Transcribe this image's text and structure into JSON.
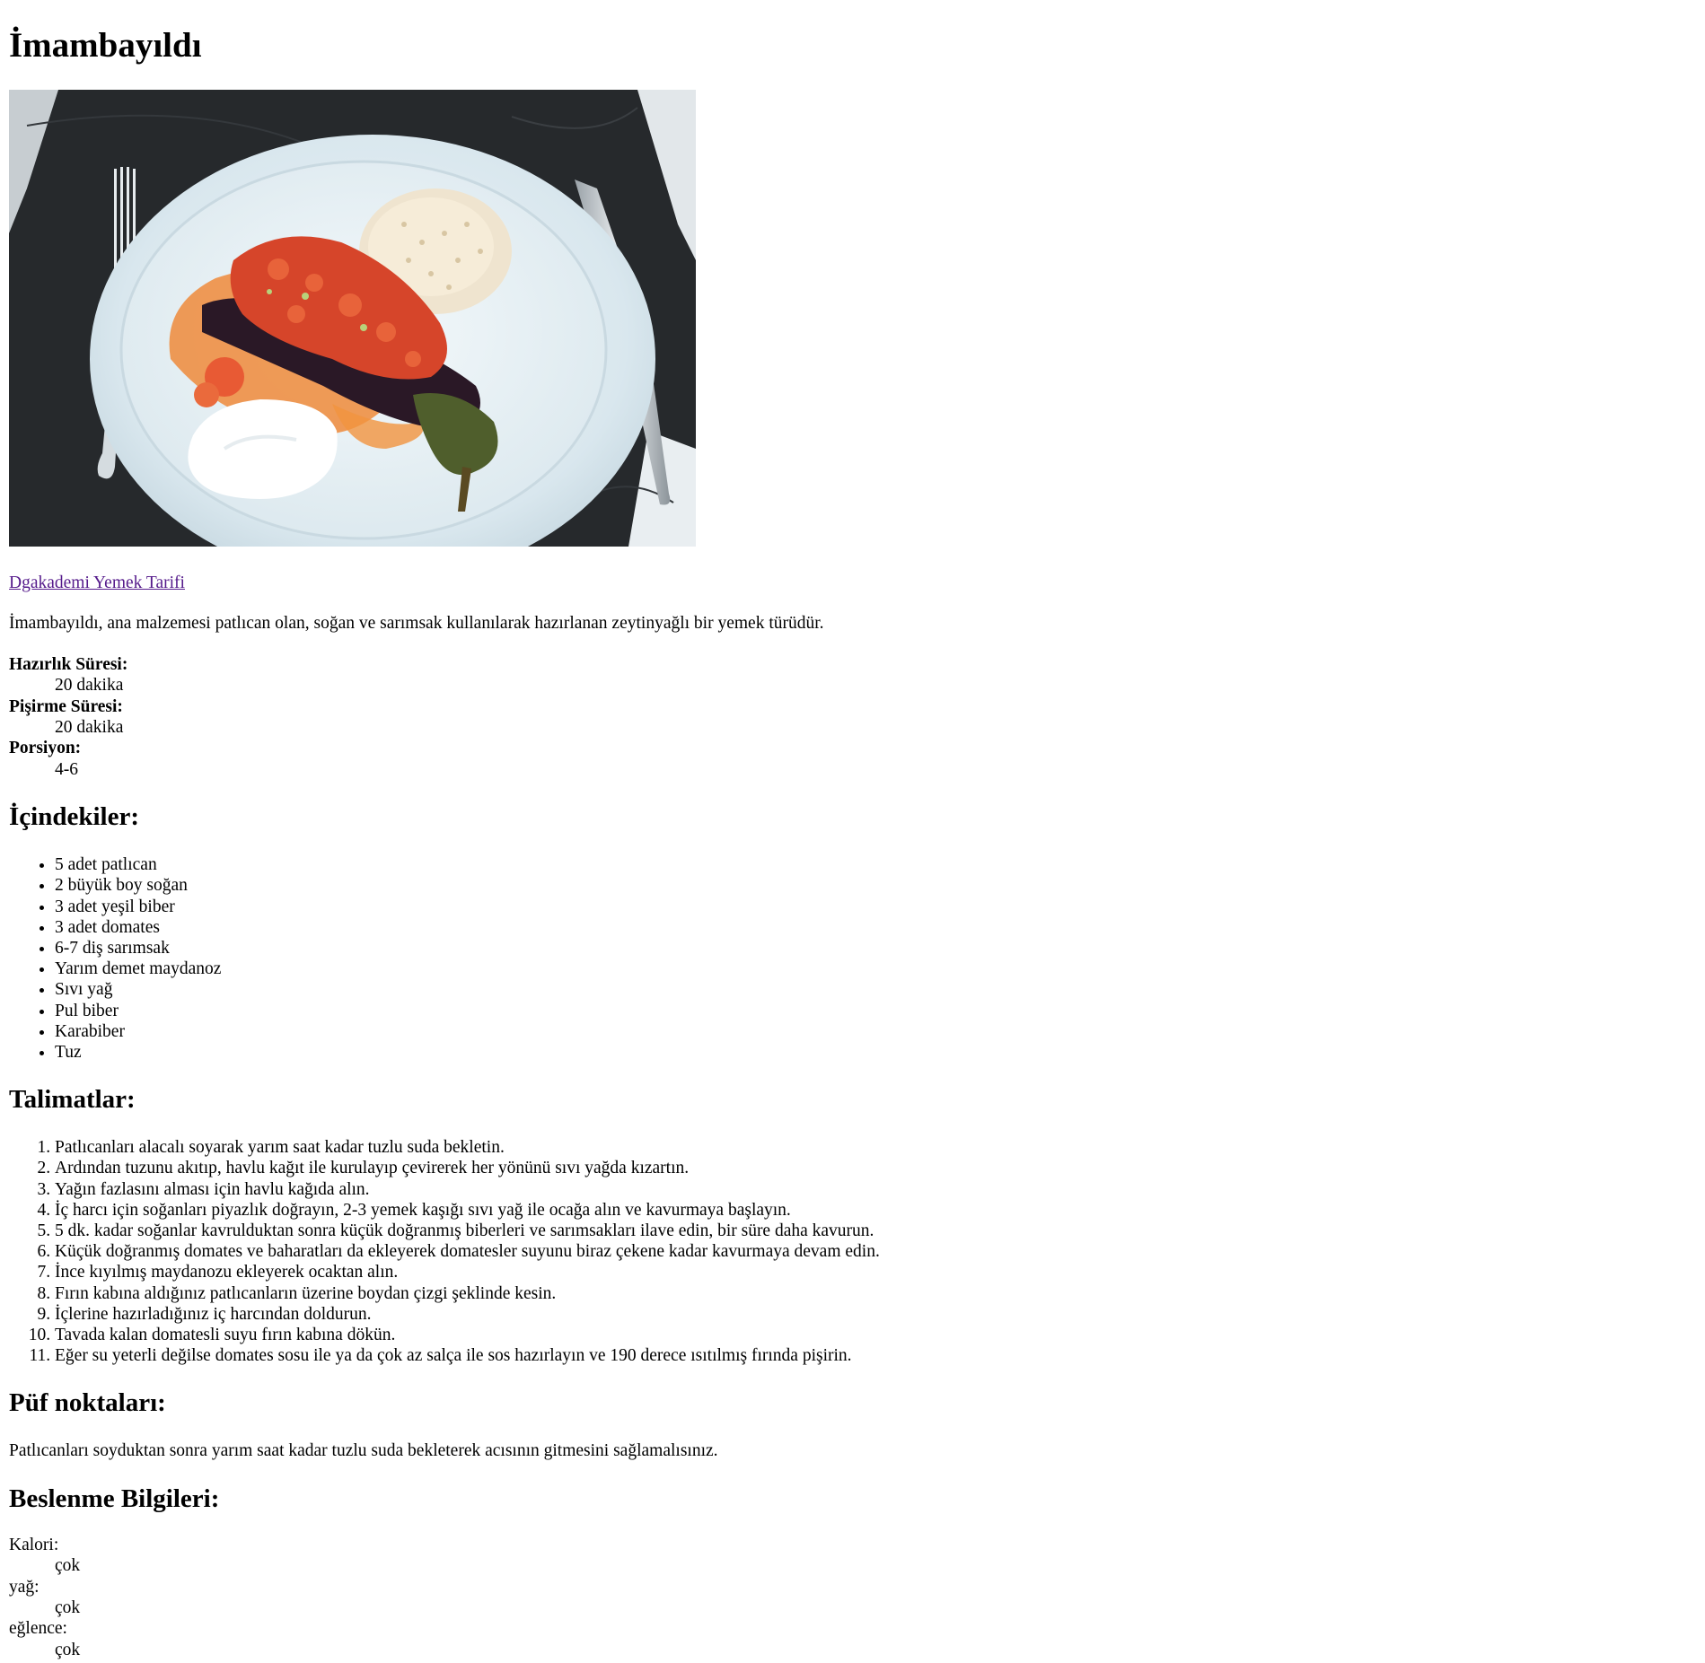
{
  "recipe": {
    "title": "İmambayıldı",
    "image_alt": "İmambayıldı",
    "source_link": "Dgakademi Yemek Tarifi",
    "description": "İmambayıldı, ana malzemesi patlıcan olan, soğan ve sarımsak kullanılarak hazırlanan zeytinyağlı bir yemek türüdür.",
    "meta": [
      {
        "label": "Hazırlık Süresi:",
        "value": "20 dakika"
      },
      {
        "label": "Pişirme Süresi:",
        "value": "20 dakika"
      },
      {
        "label": "Porsiyon:",
        "value": "4-6"
      }
    ],
    "ingredients_heading": "İçindekiler:",
    "ingredients": [
      "5 adet patlıcan",
      "2 büyük boy soğan",
      "3 adet yeşil biber",
      "3 adet domates",
      "6-7 diş sarımsak",
      "Yarım demet maydanoz",
      "Sıvı yağ",
      "Pul biber",
      "Karabiber",
      "Tuz"
    ],
    "instructions_heading": "Talimatlar:",
    "instructions": [
      "Patlıcanları alacalı soyarak yarım saat kadar tuzlu suda bekletin.",
      "Ardından tuzunu akıtıp, havlu kağıt ile kurulayıp çevirerek her yönünü sıvı yağda kızartın.",
      "Yağın fazlasını alması için havlu kağıda alın.",
      "İç harcı için soğanları piyazlık doğrayın, 2-3 yemek kaşığı sıvı yağ ile ocağa alın ve kavurmaya başlayın.",
      "5 dk. kadar soğanlar kavrulduktan sonra küçük doğranmış biberleri ve sarımsakları ilave edin, bir süre daha kavurun.",
      "Küçük doğranmış domates ve baharatları da ekleyerek domatesler suyunu biraz çekene kadar kavurmaya devam edin.",
      "İnce kıyılmış maydanozu ekleyerek ocaktan alın.",
      "Fırın kabına aldığınız patlıcanların üzerine boydan çizgi şeklinde kesin.",
      "İçlerine hazırladığınız iç harcından doldurun.",
      "Tavada kalan domatesli suyu fırın kabına dökün.",
      "Eğer su yeterli değilse domates sosu ile ya da çok az salça ile sos hazırlayın ve 190 derece ısıtılmış fırında pişirin."
    ],
    "tips_heading": "Püf noktaları:",
    "tips": "Patlıcanları soyduktan sonra yarım saat kadar tuzlu suda bekleterek acısının gitmesini sağlamalısınız.",
    "nutrition_heading": "Beslenme Bilgileri:",
    "nutrition": [
      {
        "label": "Kalori:",
        "value": "çok"
      },
      {
        "label": "yağ:",
        "value": "çok"
      },
      {
        "label": "eğlence:",
        "value": "çok"
      }
    ]
  },
  "colors": {
    "link_visited": "#551a8b",
    "text": "#000000",
    "background": "#ffffff"
  }
}
